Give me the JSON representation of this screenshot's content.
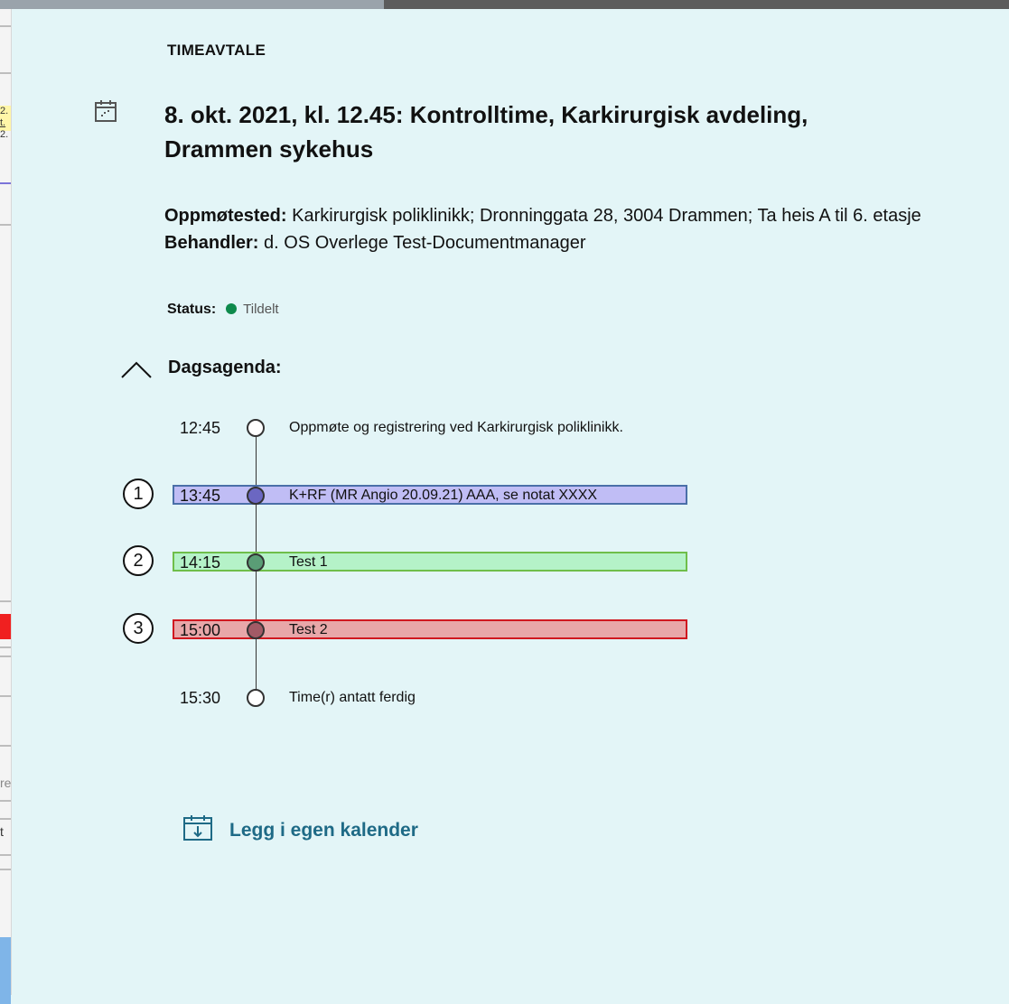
{
  "header": {
    "section_label": "TIMEAVTALE"
  },
  "appointment": {
    "title": "8. okt. 2021, kl. 12.45: Kontrolltime, Karkirurgisk avdeling, Drammen sykehus",
    "location_label": "Oppmøtested:",
    "location_value": "Karkirurgisk poliklinikk;  Dronninggata 28, 3004 Drammen; Ta heis A til 6. etasje",
    "practitioner_label": "Behandler:",
    "practitioner_value": "d. OS Overlege  Test-Documentmanager",
    "status_label": "Status:",
    "status_value": "Tildelt",
    "status_color": "#0e8a4c"
  },
  "agenda": {
    "title": "Dagsagenda:",
    "toggle_icon": "chevron-up-icon",
    "items": [
      {
        "time": "12:45",
        "description": "Oppmøte og registrering ved Karkirurgisk poliklinikk.",
        "number": "",
        "bar_color": "",
        "bar_border": "",
        "dot_color": "#ffffff"
      },
      {
        "time": "13:45",
        "description": "K+RF (MR Angio 20.09.21) AAA, se notat XXXX",
        "number": "1",
        "bar_color": "#c0bdf5",
        "bar_border": "#4a6fa8",
        "dot_color": "#6b67c2"
      },
      {
        "time": "14:15",
        "description": "Test 1",
        "number": "2",
        "bar_color": "#b5f2c8",
        "bar_border": "#6fbe4a",
        "dot_color": "#5a9d76"
      },
      {
        "time": "15:00",
        "description": "Test 2",
        "number": "3",
        "bar_color": "#e8a7a9",
        "bar_border": "#d01820",
        "dot_color": "#a25a66"
      },
      {
        "time": "15:30",
        "description": "Time(r) antatt ferdig",
        "number": "",
        "bar_color": "",
        "bar_border": "",
        "dot_color": "#ffffff"
      }
    ]
  },
  "actions": {
    "add_calendar_label": "Legg i egen kalender",
    "add_calendar_icon": "calendar-download-icon"
  },
  "background_window": {
    "fragments": [
      "2.",
      "t.",
      "2.",
      "re",
      "t"
    ]
  }
}
